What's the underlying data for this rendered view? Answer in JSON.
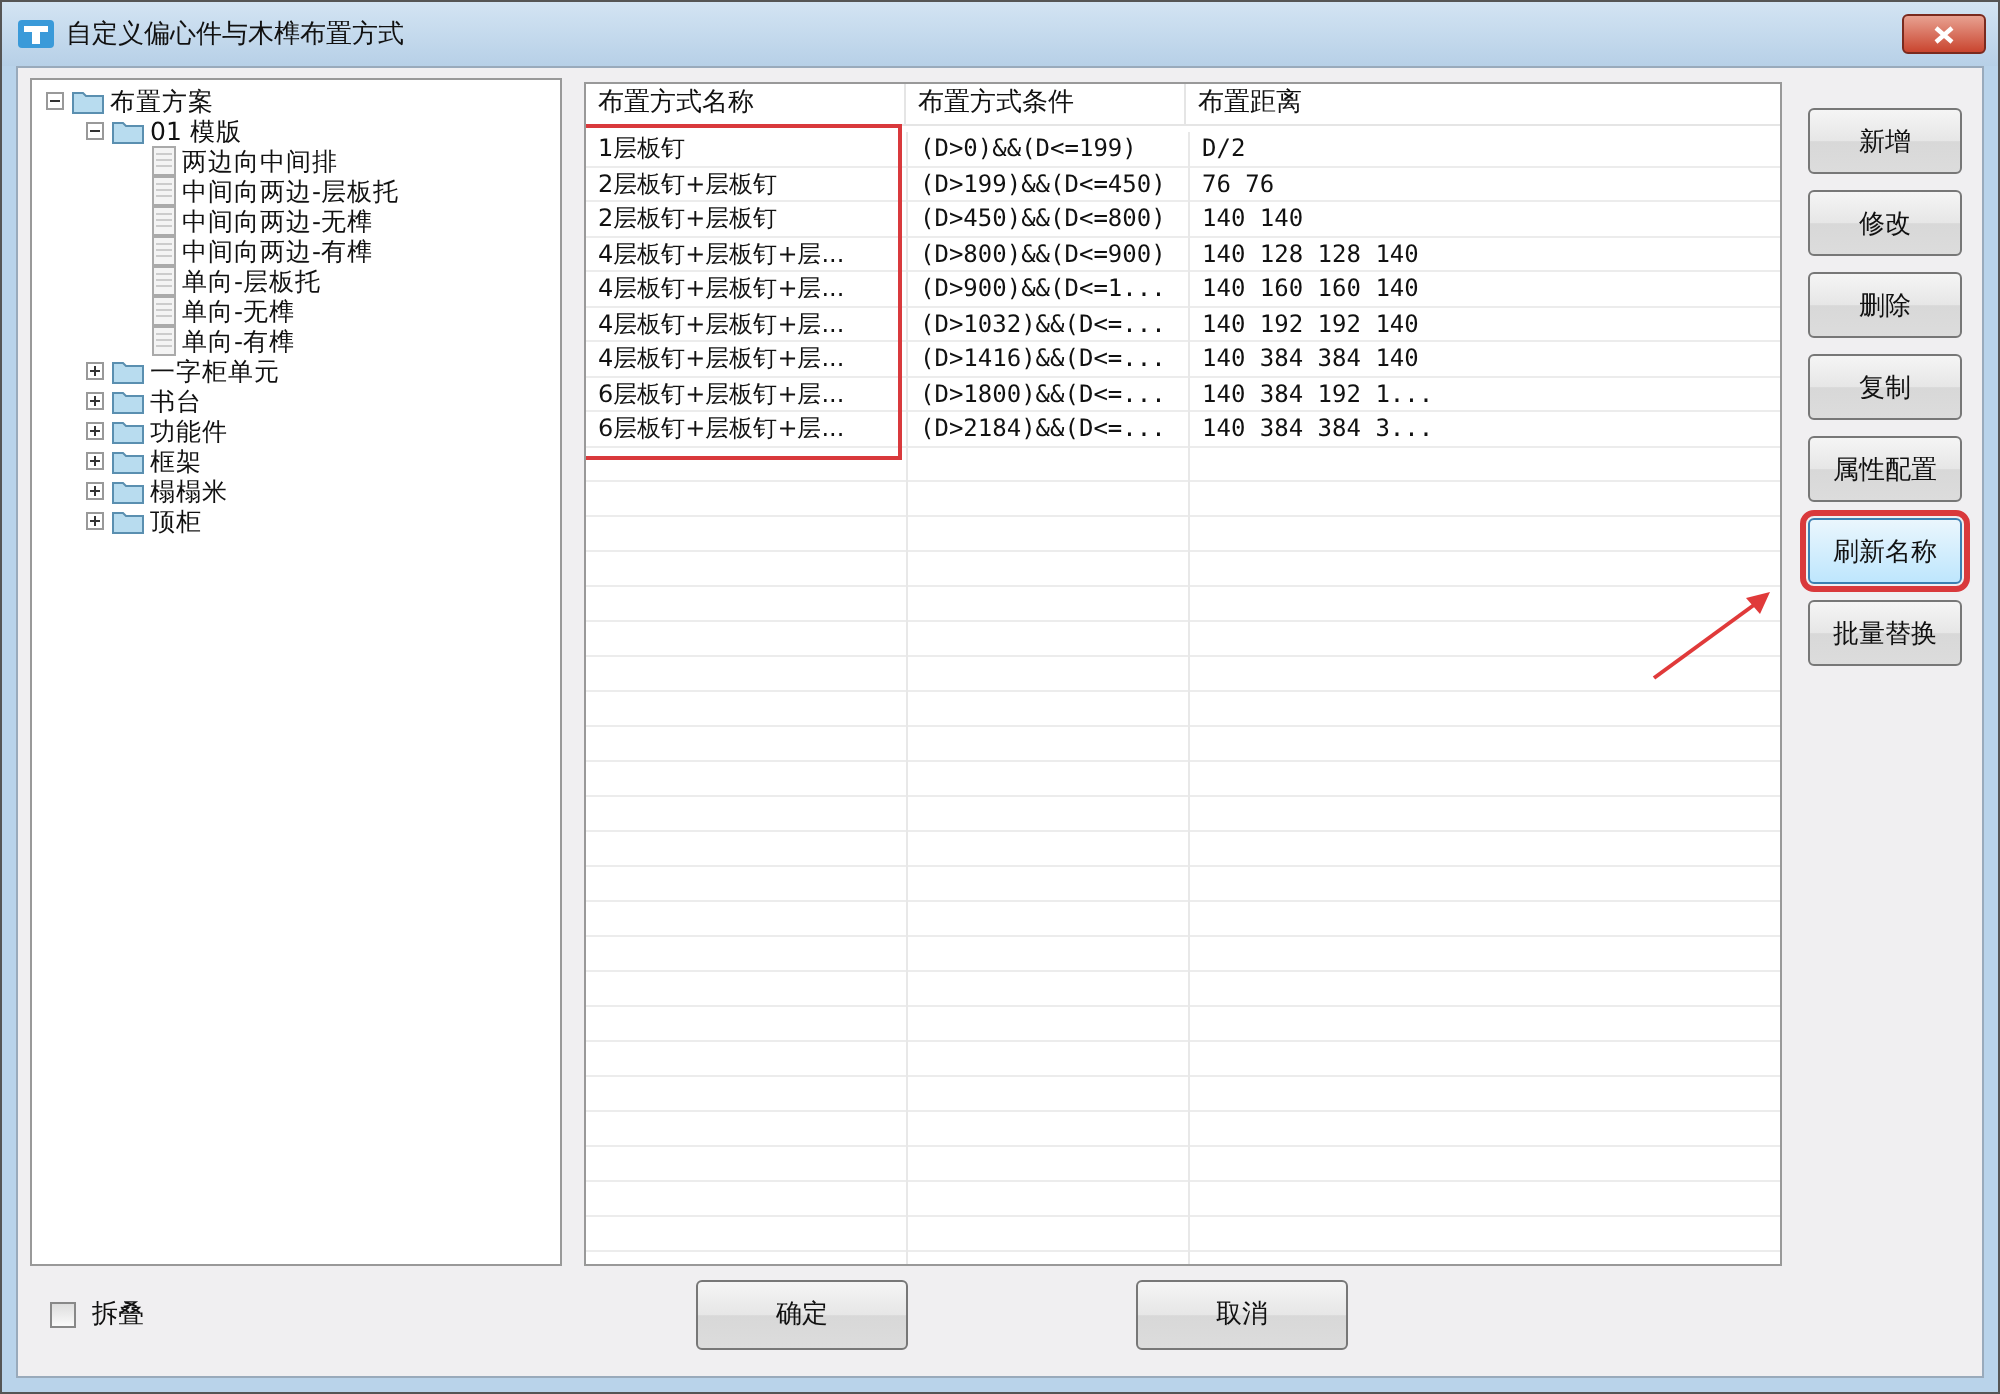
{
  "window": {
    "title": "自定义偏心件与木榫布置方式"
  },
  "tree": [
    {
      "label": "布置方案",
      "expanded": true,
      "children": [
        {
          "label": "01  模版",
          "expanded": true,
          "children": [
            {
              "label": "两边向中间排"
            },
            {
              "label": "中间向两边-层板托"
            },
            {
              "label": "中间向两边-无榫"
            },
            {
              "label": "中间向两边-有榫"
            },
            {
              "label": "单向-层板托"
            },
            {
              "label": "单向-无榫"
            },
            {
              "label": "单向-有榫"
            }
          ]
        },
        {
          "label": "一字柜单元",
          "expanded": false
        },
        {
          "label": "书台",
          "expanded": false
        },
        {
          "label": "功能件",
          "expanded": false
        },
        {
          "label": "框架",
          "expanded": false
        },
        {
          "label": "榻榻米",
          "expanded": false
        },
        {
          "label": "顶柜",
          "expanded": false
        }
      ]
    }
  ],
  "table": {
    "columns": [
      {
        "label": "布置方式名称",
        "annotated": true
      },
      {
        "label": "布置方式条件",
        "annotated": false
      },
      {
        "label": "布置距离",
        "annotated": false
      }
    ],
    "rows": [
      [
        "1层板钉",
        "(D>0)&&(D<=199)",
        "D/2"
      ],
      [
        "2层板钉+层板钉",
        "(D>199)&&(D<=450)",
        "76 76"
      ],
      [
        "2层板钉+层板钉",
        "(D>450)&&(D<=800)",
        "140 140"
      ],
      [
        "4层板钉+层板钉+层...",
        "(D>800)&&(D<=900)",
        "140 128 128 140"
      ],
      [
        "4层板钉+层板钉+层...",
        "(D>900)&&(D<=1...",
        "140 160 160 140"
      ],
      [
        "4层板钉+层板钉+层...",
        "(D>1032)&&(D<=...",
        "140 192 192 140"
      ],
      [
        "4层板钉+层板钉+层...",
        "(D>1416)&&(D<=...",
        "140 384 384 140"
      ],
      [
        "6层板钉+层板钉+层...",
        "(D>1800)&&(D<=...",
        "140 384 192 1..."
      ],
      [
        "6层板钉+层板钉+层...",
        "(D>2184)&&(D<=...",
        "140 384 384 3..."
      ]
    ]
  },
  "side_buttons": [
    {
      "label": "新增",
      "hovered": false,
      "annotated": false
    },
    {
      "label": "修改",
      "hovered": false,
      "annotated": false
    },
    {
      "label": "删除",
      "hovered": false,
      "annotated": false
    },
    {
      "label": "复制",
      "hovered": false,
      "annotated": false
    },
    {
      "label": "属性配置",
      "hovered": false,
      "annotated": false
    },
    {
      "label": "刷新名称",
      "hovered": true,
      "annotated": true
    },
    {
      "label": "批量替换",
      "hovered": false,
      "annotated": false
    }
  ],
  "collapse_checkbox": {
    "label": "拆叠",
    "checked": false
  },
  "dialog_buttons": [
    {
      "label": "确定"
    },
    {
      "label": "取消"
    }
  ]
}
